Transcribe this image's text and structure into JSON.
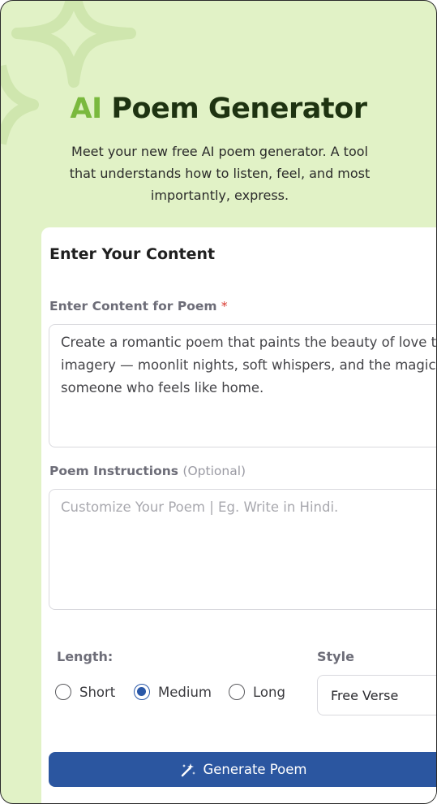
{
  "header": {
    "title_accent": "AI",
    "title_rest": "Poem Generator",
    "subtitle": "Meet your new free AI poem generator. A tool that understands how to listen, feel, and most importantly, express."
  },
  "form": {
    "heading": "Enter Your Content",
    "content_label": "Enter Content for Poem",
    "required_mark": "*",
    "content_value": "Create a romantic poem that paints the beauty of love thr\nimagery — moonlit nights, soft whispers, and the magic o\nsomeone who feels like home.",
    "instructions_label": "Poem Instructions",
    "instructions_optional": "(Optional)",
    "instructions_placeholder": "Customize Your Poem | Eg. Write in Hindi.",
    "length_label": "Length:",
    "length_options": [
      {
        "label": "Short",
        "checked": false
      },
      {
        "label": "Medium",
        "checked": true
      },
      {
        "label": "Long",
        "checked": false
      }
    ],
    "style_label": "Style",
    "style_value": "Free Verse",
    "generate_label": "Generate Poem"
  },
  "colors": {
    "background": "#e1f2c6",
    "accent_green": "#7ab93e",
    "title_dark": "#1e3311",
    "primary_blue": "#2b56a0",
    "required_red": "#d9382e"
  },
  "icons": [
    "sparkle-star-decoration-icon",
    "magic-wand-icon"
  ]
}
